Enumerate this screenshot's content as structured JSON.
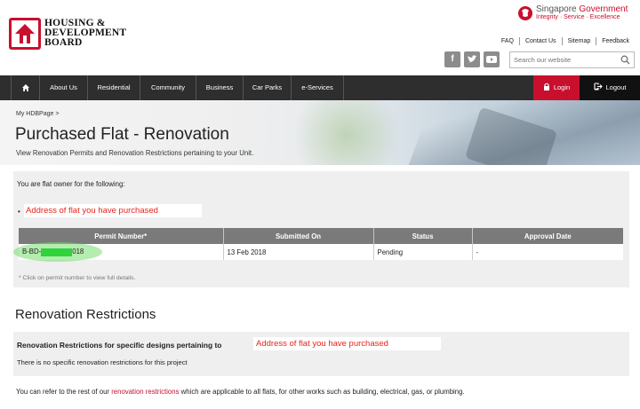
{
  "header": {
    "logo_lines": [
      "HOUSING &",
      "DEVELOPMENT",
      "BOARD"
    ],
    "sg_title_prefix": "Singapore",
    "sg_title_suffix": "Government",
    "sg_motto": "Integrity · Service · Excellence",
    "toplinks": [
      "FAQ",
      "Contact Us",
      "Sitemap",
      "Feedback"
    ],
    "social_icons": [
      "facebook-icon",
      "twitter-icon",
      "youtube-icon"
    ],
    "search_placeholder": "Search our website"
  },
  "nav": {
    "items": [
      "About Us",
      "Residential",
      "Community",
      "Business",
      "Car Parks",
      "e-Services"
    ],
    "login": "Login",
    "logout": "Logout"
  },
  "banner": {
    "breadcrumb": "My HDBPage >",
    "title": "Purchased Flat - Renovation",
    "subtitle": "View Renovation Permits and Renovation Restrictions pertaining to your Unit."
  },
  "owner": {
    "line": "You are flat owner for the following:",
    "address": "Address of flat you have purchased"
  },
  "permits": {
    "headers": [
      "Permit Number*",
      "Submitted On",
      "Status",
      "Approval Date"
    ],
    "rows": [
      {
        "permit_prefix": "B-BD-",
        "permit_suffix": "018",
        "submitted": "13 Feb 2018",
        "status": "Pending",
        "approval": "-"
      }
    ],
    "note": "* Click on permit number to view full details."
  },
  "restrictions": {
    "title": "Renovation Restrictions",
    "heading": "Renovation Restrictions for specific designs pertaining to",
    "address": "Address of flat you have purchased",
    "none_text": "There is no specific renovation restrictions for this project",
    "refer_prefix": "You can refer to the rest of our ",
    "refer_link": "renovation restrictions",
    "refer_suffix": " which are applicable to all flats, for other works such as building, electrical, gas, or plumbing."
  },
  "colors": {
    "brand_red": "#c8102e",
    "nav_bg": "#2e2e2e",
    "highlight_green": "#2fd43a",
    "address_red": "#e8231b"
  }
}
